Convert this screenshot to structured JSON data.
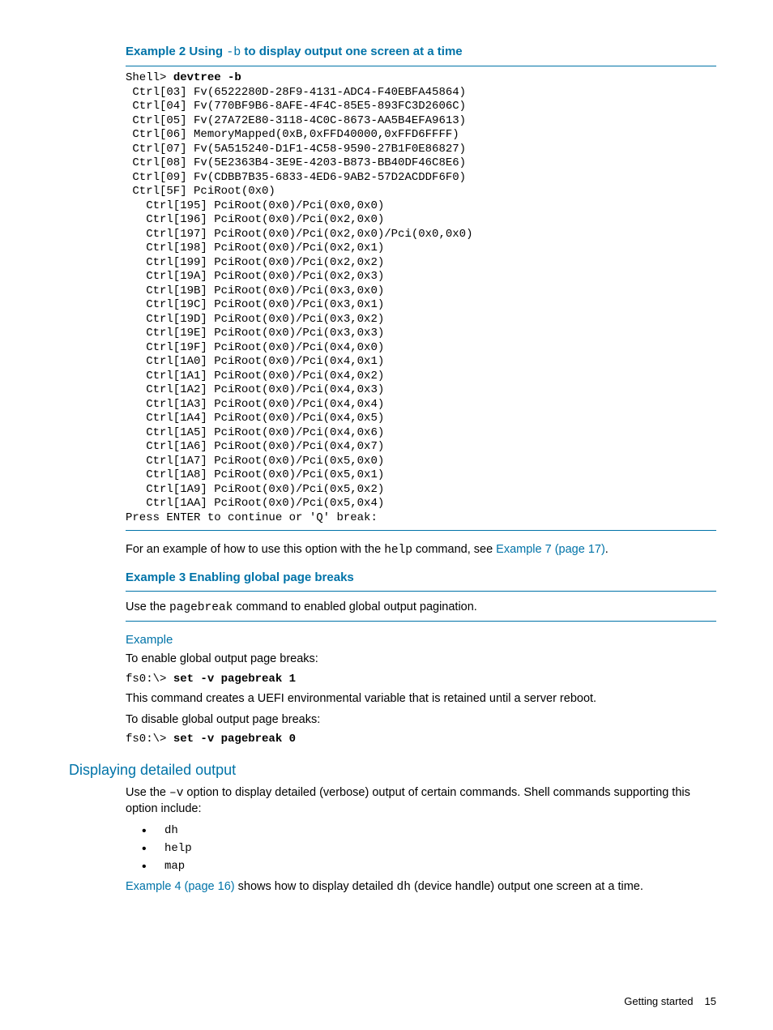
{
  "example2": {
    "heading_pre": "Example 2 Using ",
    "heading_mono": "-b",
    "heading_post": " to display output one screen at a time",
    "prompt": "Shell> ",
    "cmd": "devtree -b",
    "lines": [
      " Ctrl[03] Fv(6522280D-28F9-4131-ADC4-F40EBFA45864)",
      " Ctrl[04] Fv(770BF9B6-8AFE-4F4C-85E5-893FC3D2606C)",
      " Ctrl[05] Fv(27A72E80-3118-4C0C-8673-AA5B4EFA9613)",
      " Ctrl[06] MemoryMapped(0xB,0xFFD40000,0xFFD6FFFF)",
      " Ctrl[07] Fv(5A515240-D1F1-4C58-9590-27B1F0E86827)",
      " Ctrl[08] Fv(5E2363B4-3E9E-4203-B873-BB40DF46C8E6)",
      " Ctrl[09] Fv(CDBB7B35-6833-4ED6-9AB2-57D2ACDDF6F0)",
      " Ctrl[5F] PciRoot(0x0)",
      "   Ctrl[195] PciRoot(0x0)/Pci(0x0,0x0)",
      "   Ctrl[196] PciRoot(0x0)/Pci(0x2,0x0)",
      "   Ctrl[197] PciRoot(0x0)/Pci(0x2,0x0)/Pci(0x0,0x0)",
      "   Ctrl[198] PciRoot(0x0)/Pci(0x2,0x1)",
      "   Ctrl[199] PciRoot(0x0)/Pci(0x2,0x2)",
      "   Ctrl[19A] PciRoot(0x0)/Pci(0x2,0x3)",
      "   Ctrl[19B] PciRoot(0x0)/Pci(0x3,0x0)",
      "   Ctrl[19C] PciRoot(0x0)/Pci(0x3,0x1)",
      "   Ctrl[19D] PciRoot(0x0)/Pci(0x3,0x2)",
      "   Ctrl[19E] PciRoot(0x0)/Pci(0x3,0x3)",
      "   Ctrl[19F] PciRoot(0x0)/Pci(0x4,0x0)",
      "   Ctrl[1A0] PciRoot(0x0)/Pci(0x4,0x1)",
      "   Ctrl[1A1] PciRoot(0x0)/Pci(0x4,0x2)",
      "   Ctrl[1A2] PciRoot(0x0)/Pci(0x4,0x3)",
      "   Ctrl[1A3] PciRoot(0x0)/Pci(0x4,0x4)",
      "   Ctrl[1A4] PciRoot(0x0)/Pci(0x4,0x5)",
      "   Ctrl[1A5] PciRoot(0x0)/Pci(0x4,0x6)",
      "   Ctrl[1A6] PciRoot(0x0)/Pci(0x4,0x7)",
      "   Ctrl[1A7] PciRoot(0x0)/Pci(0x5,0x0)",
      "   Ctrl[1A8] PciRoot(0x0)/Pci(0x5,0x1)",
      "   Ctrl[1A9] PciRoot(0x0)/Pci(0x5,0x2)",
      "   Ctrl[1AA] PciRoot(0x0)/Pci(0x5,0x4)",
      "Press ENTER to continue or 'Q' break:"
    ]
  },
  "para1": {
    "pre": "For an example of how to use this option with the ",
    "mono": "help",
    "mid": " command, see ",
    "link": "Example 7 (page 17)",
    "post": "."
  },
  "example3": {
    "heading": "Example 3 Enabling global page breaks",
    "para_pre": "Use the ",
    "para_mono": "pagebreak",
    "para_post": " command to enabled global output pagination.",
    "sub": "Example",
    "enable_text": "To enable global output page breaks:",
    "enable_prompt": "fs0:\\> ",
    "enable_cmd": "set -v pagebreak 1",
    "retain_text": "This command creates a UEFI environmental variable that is retained until a server reboot.",
    "disable_text": "To disable global output page breaks:",
    "disable_prompt": "fs0:\\> ",
    "disable_cmd": "set -v pagebreak 0"
  },
  "detailed": {
    "heading": "Displaying detailed output",
    "para_pre": "Use the ",
    "para_mono": " –v",
    "para_post": " option to display detailed (verbose) output of certain commands. Shell commands supporting this option include:",
    "bullets": [
      "dh",
      "help",
      "map"
    ],
    "link": "Example 4 (page 16)",
    "after_link": " shows how to display detailed ",
    "mono": "dh",
    "after_mono": " (device handle) output one screen at a time."
  },
  "footer": {
    "label": "Getting started",
    "page": "15"
  }
}
